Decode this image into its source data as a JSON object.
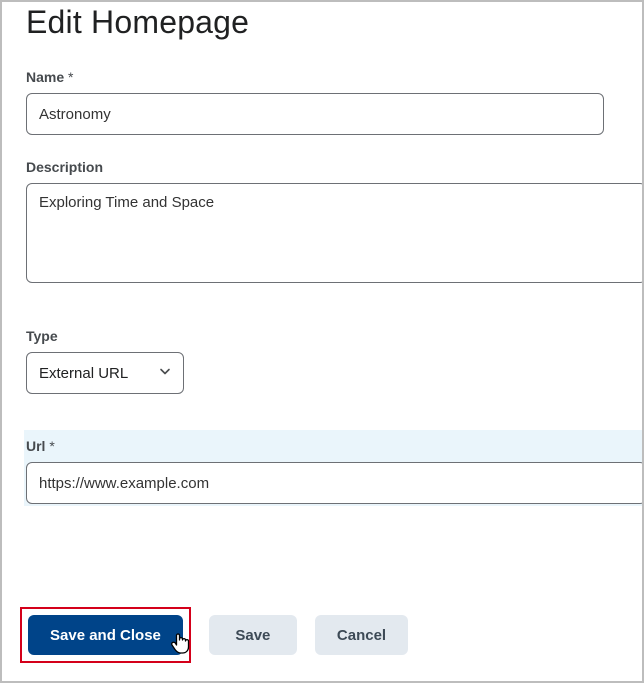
{
  "page": {
    "title": "Edit Homepage"
  },
  "fields": {
    "name": {
      "label": "Name",
      "value": "Astronomy"
    },
    "description": {
      "label": "Description",
      "value": "Exploring Time and Space"
    },
    "type": {
      "label": "Type",
      "value": "External URL"
    },
    "url": {
      "label": "Url",
      "value": "https://www.example.com"
    }
  },
  "buttons": {
    "saveClose": "Save and Close",
    "save": "Save",
    "cancel": "Cancel"
  }
}
